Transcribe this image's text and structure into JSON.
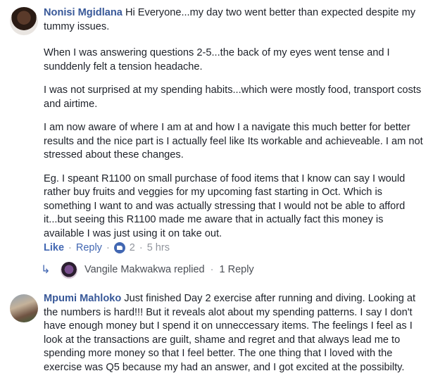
{
  "comment1": {
    "author": "Nonisi Mgidlana",
    "lead": "Hi Everyone...my day two went better than expected despite my tummy issues.",
    "paragraphs": [
      "When I was answering questions 2-5...the back of my eyes went tense and I sunddenly felt a tension headache.",
      "I was not surprised at my spending habits...which were mostly food, transport costs and airtime.",
      "I am now aware of where I am at and how I a navigate this much better for better results and the nice part is I actually feel like Its workable and achieveable. I am not stressed about these changes.",
      "Eg. I speant R1100 on small purchase of food items that I know can say I would rather buy fruits and veggies for my upcoming fast starting in Oct. Which is something I want to and was actually stressing that I would not be able to afford it...but seeing this R1100 made me aware that in actually fact this money is available I was just using it on take out."
    ],
    "actions": {
      "like": "Like",
      "reply": "Reply",
      "reaction_count": "2",
      "time": "5 hrs"
    },
    "reply_summary": {
      "text": "Vangile Makwakwa replied",
      "count_link": "1 Reply"
    }
  },
  "comment2": {
    "author": "Mpumi Mahloko",
    "text": "Just finished Day 2 exercise after running and diving. Looking at the numbers is hard!!! But it reveals alot about my spending patterns. I say I don't have enough money but I spend it on unneccessary items. The feelings I feel as I look at the transactions are guilt, shame and regret and that always lead me to spending more money so that I feel better. The one thing that I loved with the exercise was Q5 because my had an answer, and I got excited at the possibilty."
  },
  "colors": {
    "link": "#385898",
    "action": "#4267b2",
    "meta": "#90949c",
    "text": "#1d2129"
  }
}
